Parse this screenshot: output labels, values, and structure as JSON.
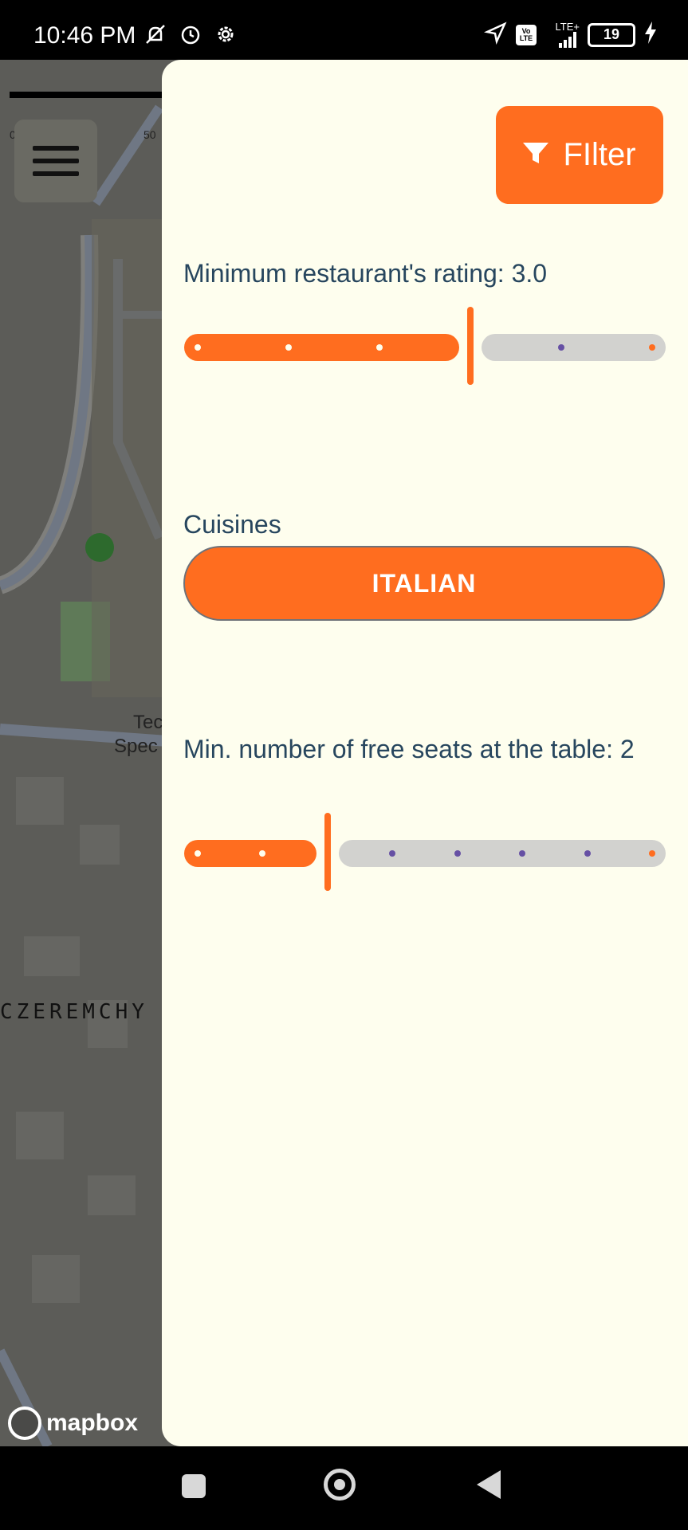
{
  "status_bar": {
    "time": "10:46 PM",
    "network": "LTE+",
    "volte": "Vo LTE",
    "battery": "19",
    "left_icons": [
      "muted-icon",
      "alarm-icon",
      "settings-icon"
    ],
    "right_icons": [
      "location-icon",
      "volte-icon",
      "signal-icon",
      "battery-icon",
      "charging-icon"
    ]
  },
  "map": {
    "scale_start": "0",
    "scale_end": "50",
    "street_name": "CZEREMCHY",
    "poi_line1": "Tec",
    "poi_line2": "Spec",
    "attribution": "mapbox"
  },
  "drawer": {
    "filter_button": {
      "label": "FIlter",
      "icon": "filter-icon"
    },
    "rating": {
      "label": "Minimum restaurant's rating: 3.0",
      "value": 3.0,
      "min": 0,
      "max": 5,
      "steps": 6
    },
    "cuisines": {
      "label": "Cuisines",
      "selected": "ITALIAN"
    },
    "seats": {
      "label": "Min. number of free seats at the table: 2",
      "value": 2,
      "min": 0,
      "max": 7,
      "steps": 8
    }
  },
  "nav_bar": {
    "icons": [
      "recents-icon",
      "home-icon",
      "back-icon"
    ]
  },
  "colors": {
    "accent": "#ff6d1f",
    "panel_bg": "#fefeee",
    "label_text": "#27465e",
    "inactive_track": "#d2d2cf",
    "tick_inactive": "#6650a4"
  }
}
